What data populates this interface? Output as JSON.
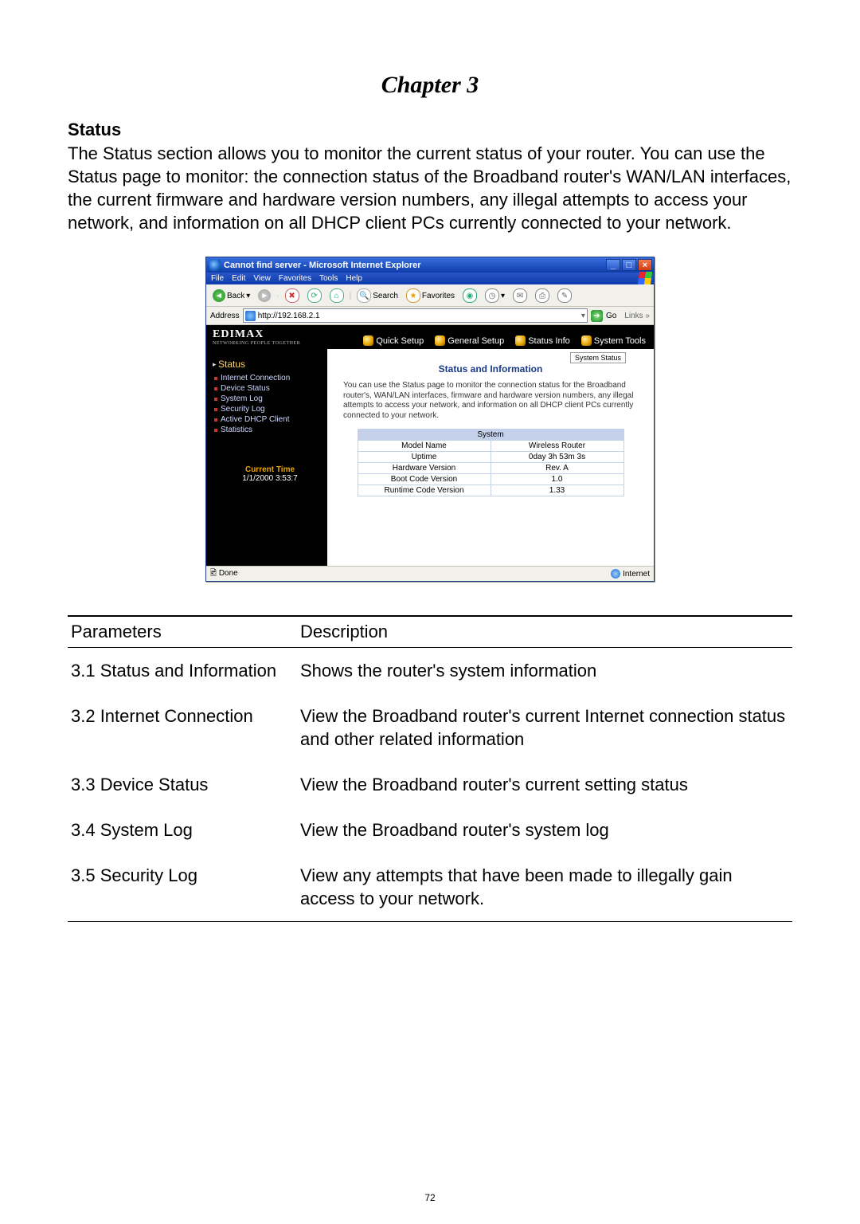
{
  "chapter_title": "Chapter 3",
  "section_title": "Status",
  "body_text": "The Status section allows you to monitor the current status of your router. You can use the Status page to monitor: the connection status of the Broadband router's WAN/LAN interfaces, the current firmware and hardware version numbers, any illegal attempts to access your network, and information on all DHCP client PCs currently connected to your network.",
  "ie": {
    "title": "Cannot find server - Microsoft Internet Explorer",
    "menus": [
      "File",
      "Edit",
      "View",
      "Favorites",
      "Tools",
      "Help"
    ],
    "toolbar": {
      "back": "Back",
      "search": "Search",
      "favorites": "Favorites"
    },
    "address_label": "Address",
    "address_value": "http://192.168.2.1",
    "go_label": "Go",
    "links_label": "Links",
    "status_done": "Done",
    "status_zone": "Internet"
  },
  "router": {
    "brand": "EDIMAX",
    "tagline": "NETWORKING PEOPLE TOGETHER",
    "tabs": [
      "Quick Setup",
      "General Setup",
      "Status Info",
      "System Tools"
    ],
    "sidebar_head": "Status",
    "sidebar_items": [
      "Internet Connection",
      "Device Status",
      "System Log",
      "Security Log",
      "Active DHCP Client",
      "Statistics"
    ],
    "time_label": "Current Time",
    "time_value": "1/1/2000 3:53:7",
    "small_tab": "System Status",
    "page_heading": "Status and Information",
    "page_desc": "You can use the Status page to monitor the connection status for the Broadband router's, WAN/LAN interfaces, firmware and hardware version numbers, any illegal attempts to access your network, and information on all DHCP client PCs currently connected to your network.",
    "sys_table_header": "System",
    "sys_rows": [
      {
        "k": "Model Name",
        "v": "Wireless Router"
      },
      {
        "k": "Uptime",
        "v": "0day 3h 53m 3s"
      },
      {
        "k": "Hardware Version",
        "v": "Rev. A"
      },
      {
        "k": "Boot Code Version",
        "v": "1.0"
      },
      {
        "k": "Runtime Code Version",
        "v": "1.33"
      }
    ]
  },
  "params_head": {
    "p": "Parameters",
    "d": "Description"
  },
  "params": [
    {
      "p": "3.1 Status and Information",
      "d": "Shows the router's system information"
    },
    {
      "p": "3.2 Internet Connection",
      "d": "View the Broadband router's current Internet connection status and other related information"
    },
    {
      "p": "3.3 Device Status",
      "d": "View the Broadband router's current setting status"
    },
    {
      "p": "3.4 System Log",
      "d": "View the Broadband router's system log"
    },
    {
      "p": "3.5 Security Log",
      "d": "View any attempts that have been made to illegally gain access to your network."
    }
  ],
  "page_number": "72"
}
